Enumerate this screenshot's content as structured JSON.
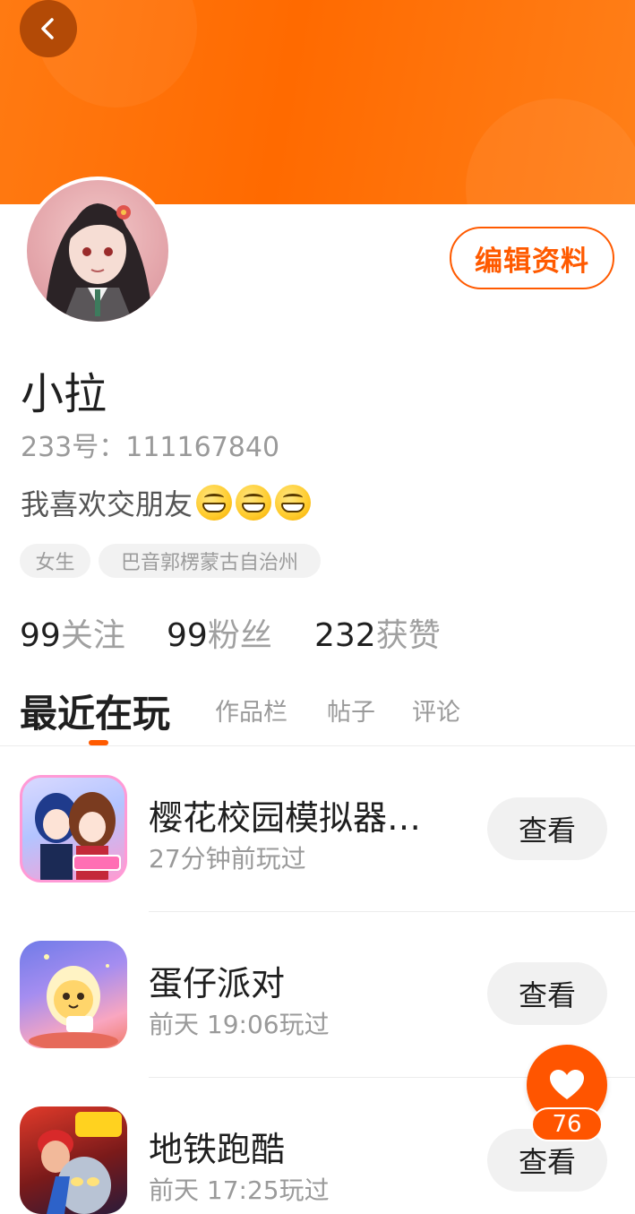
{
  "header": {
    "gradient_start": "#ff7a12",
    "gradient_end": "#ff7f18",
    "back_icon": "chevron-left-icon"
  },
  "profile": {
    "edit_label": "编辑资料",
    "name": "小拉",
    "uid": "233号：111167840",
    "bio_text": "我喜欢交朋友",
    "bio_emojis": [
      "grinning-face-icon",
      "grinning-face-icon",
      "grinning-face-icon"
    ],
    "tags": [
      "女生",
      "巴音郭楞蒙古自治州"
    ]
  },
  "stats": [
    {
      "num": "99",
      "label": "关注"
    },
    {
      "num": "99",
      "label": "粉丝"
    },
    {
      "num": "232",
      "label": "获赞"
    }
  ],
  "tabs": [
    {
      "label": "最近在玩",
      "active": true
    },
    {
      "label": "作品栏",
      "active": false
    },
    {
      "label": "帖子",
      "active": false
    },
    {
      "label": "评论",
      "active": false
    }
  ],
  "games": [
    {
      "title": "樱花校园模拟器…",
      "time": "27分钟前玩过",
      "button": "查看",
      "icon": "sakura-school-game-icon"
    },
    {
      "title": "蛋仔派对",
      "time": "前天 19:06玩过",
      "button": "查看",
      "icon": "eggy-party-game-icon"
    },
    {
      "title": "地铁跑酷",
      "time": "前天 17:25玩过",
      "button": "查看",
      "icon": "subway-surfers-game-icon"
    }
  ],
  "like": {
    "icon": "heart-icon",
    "count": "76",
    "color": "#ff5500"
  },
  "accent_color": "#ff5a00"
}
